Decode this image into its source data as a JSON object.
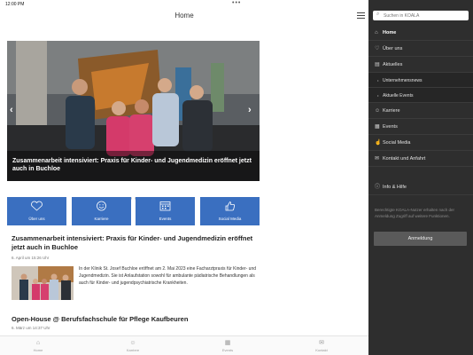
{
  "status": {
    "time": "12:00 PM",
    "dots": "•••"
  },
  "header": {
    "title": "Home"
  },
  "hero": {
    "caption": "Zusammenarbeit intensiviert: Praxis für Kinder- und Jugendmedizin eröffnet jetzt auch in Buchloe",
    "prev": "‹",
    "next": "›"
  },
  "tiles": [
    {
      "label": "Über uns",
      "icon": "heart-icon"
    },
    {
      "label": "Karriere",
      "icon": "smile-icon"
    },
    {
      "label": "Events",
      "icon": "calendar-icon"
    },
    {
      "label": "Social Media",
      "icon": "thumbs-up-icon"
    }
  ],
  "article1": {
    "title": "Zusammenarbeit intensiviert: Praxis für Kinder- und Jugendmedizin eröffnet jetzt auch in Buchloe",
    "date": "6. April um 15:26 Uhr",
    "excerpt": "In der Klinik St. Josef Buchloe eröffnet am 2. Mai 2023 eine Facharztpraxis für Kinder- und Jugendmedizin. Sie ist Anlaufstation sowohl für ambulante pädiatrische Behandlungen als auch für Kinder- und jugendpsychiatrische Krankheiten."
  },
  "article2": {
    "title": "Open-House @ Berufsfachschule für Pflege Kaufbeuren",
    "date": "6. März um 14:37 Uhr"
  },
  "tabbar": [
    {
      "label": "Home",
      "icon": "home-icon"
    },
    {
      "label": "Karriere",
      "icon": "smile-icon"
    },
    {
      "label": "Events",
      "icon": "calendar-icon"
    },
    {
      "label": "Kontakt",
      "icon": "mail-icon"
    }
  ],
  "sidebar": {
    "search_placeholder": "Suchen in KOALA",
    "items": [
      {
        "label": "Home",
        "icon": "home-icon"
      },
      {
        "label": "Über uns",
        "icon": "heart-icon"
      },
      {
        "label": "Aktuelles",
        "icon": "news-icon"
      },
      {
        "label": "Unternehmensnews",
        "icon": "bullet-icon"
      },
      {
        "label": "Aktuelle Events",
        "icon": "bullet-icon"
      },
      {
        "label": "Karriere",
        "icon": "smile-icon"
      },
      {
        "label": "Events",
        "icon": "calendar-icon"
      },
      {
        "label": "Social Media",
        "icon": "thumbs-up-icon"
      },
      {
        "label": "Kontakt und Anfahrt",
        "icon": "mail-icon"
      },
      {
        "label": "Info & Hilfe",
        "icon": "info-icon"
      }
    ],
    "login_note": "Berechtigte KOALA-Nutzer erhalten nach der Anmeldung Zugriff auf weitere Funktionen.",
    "login_button": "Anmeldung"
  },
  "colors": {
    "accent": "#3a6fc0",
    "sidebar": "#2e2e2e"
  }
}
